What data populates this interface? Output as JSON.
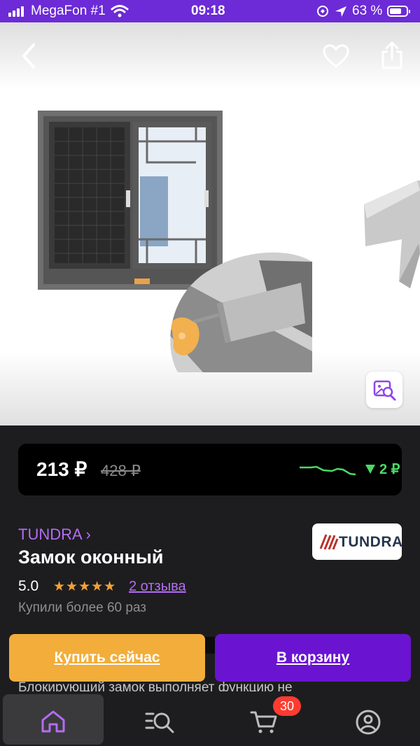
{
  "status_bar": {
    "carrier": "MegaFon #1",
    "time": "09:18",
    "battery_percent": "63 %",
    "color": "#6c2bd6"
  },
  "gallery": {
    "back_icon": "chevron-left-icon",
    "favorite_icon": "heart-icon",
    "share_icon": "share-icon",
    "visual_search_icon": "image-search-icon"
  },
  "price": {
    "current": "213 ₽",
    "old": "428 ₽",
    "delta": "2 ₽",
    "delta_color": "#4cd964"
  },
  "product": {
    "brand": "TUNDRA ›",
    "brand_logo_text": "TUNDRA",
    "title": "Замок оконный",
    "rating": "5.0",
    "stars": "★★★★★",
    "rating_stars_out_of_5": 5,
    "reviews": "2 отзыва",
    "purchased": "Купили более 60 раз",
    "description_fragment": "Блокирующий замок выполняет функцию не"
  },
  "actions": {
    "buy_now": "Купить сейчас",
    "add_to_cart": "В корзину",
    "buy_color": "#f2ad3b",
    "cart_color": "#6a14d1"
  },
  "tab_bar": {
    "items": [
      {
        "icon": "home-icon",
        "active": true
      },
      {
        "icon": "catalog-search-icon",
        "active": false
      },
      {
        "icon": "cart-icon",
        "active": false
      },
      {
        "icon": "profile-icon",
        "active": false
      }
    ],
    "cart_count": "30",
    "active_color": "#b56cf5"
  }
}
